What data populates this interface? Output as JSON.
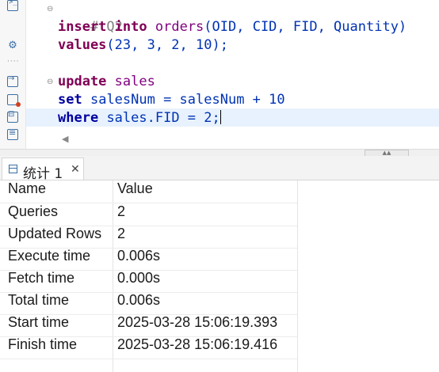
{
  "editor": {
    "lines": [
      {
        "type": "comment",
        "text": "# Q2"
      },
      {
        "type": "insert"
      },
      {
        "type": "values"
      },
      {
        "type": "blank"
      },
      {
        "type": "update"
      },
      {
        "type": "set"
      },
      {
        "type": "where"
      }
    ],
    "comment": "# Q2",
    "insert_kw1": "insert",
    "insert_kw2": "into",
    "insert_table": "orders",
    "insert_cols": "(OID, CID, FID, Quantity)",
    "values_kw": "values",
    "values_args": "(23, 3, 2, 10);",
    "update_kw": "update",
    "update_table": "sales",
    "set_kw": "set",
    "set_expr": "salesNum = salesNum + 10",
    "where_kw": "where",
    "where_expr": "sales.FID = 2;"
  },
  "results_tab": {
    "label": "统计 1",
    "close": "✕"
  },
  "results": {
    "header": {
      "name": "Name",
      "value": "Value"
    },
    "rows": [
      {
        "name": "Queries",
        "value": "2"
      },
      {
        "name": "Updated Rows",
        "value": "2"
      },
      {
        "name": "Execute time",
        "value": "0.006s"
      },
      {
        "name": "Fetch time",
        "value": "0.000s"
      },
      {
        "name": "Total time",
        "value": "0.006s"
      },
      {
        "name": "Start time",
        "value": "2025-03-28 15:06:19.393"
      },
      {
        "name": "Finish time",
        "value": "2025-03-28 15:06:19.416"
      }
    ]
  },
  "icons": {
    "gutter": [
      "terminal-icon",
      "gear-icon",
      "dots-icon",
      "arrow-icon",
      "doc-error-icon",
      "doc-icon",
      "list-icon"
    ],
    "scroll_left": "◀",
    "splitter_grip": "▲▲"
  }
}
